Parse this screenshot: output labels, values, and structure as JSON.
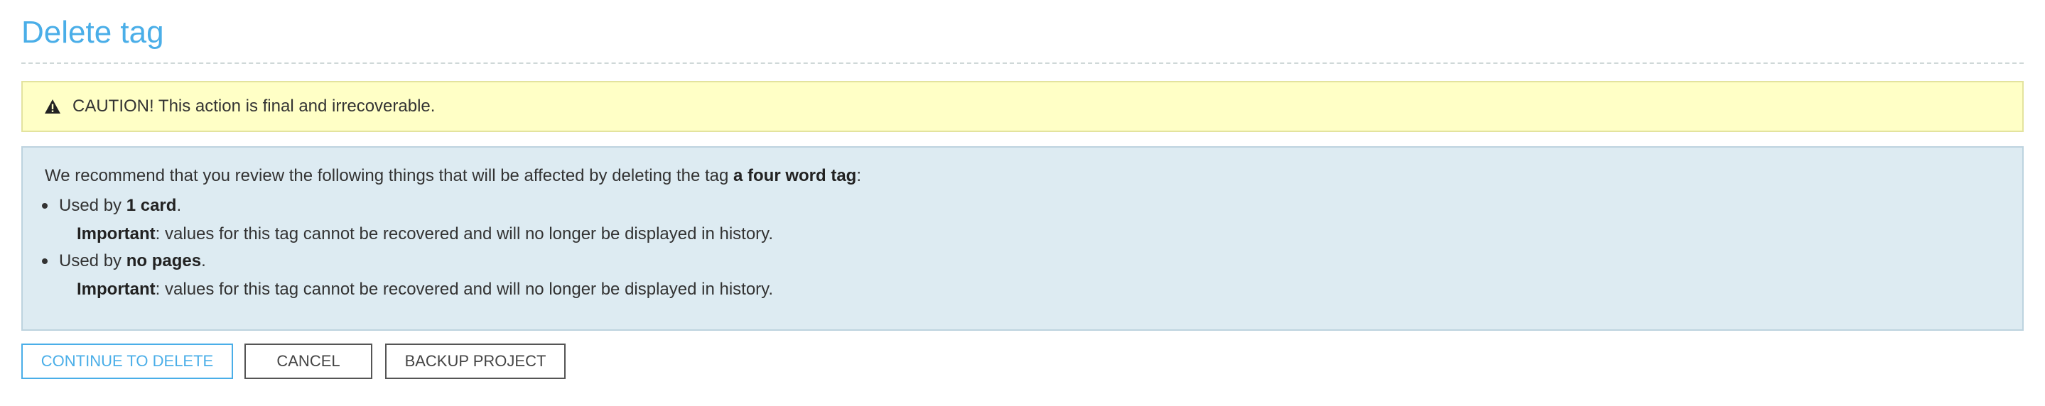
{
  "page": {
    "title": "Delete tag"
  },
  "caution": {
    "icon": "warning-triangle-icon",
    "text": "CAUTION! This action is final and irrecoverable."
  },
  "info": {
    "intro_prefix": "We recommend that you review the following things that will be affected by deleting the tag ",
    "tag_name": "a four word tag",
    "intro_suffix": ":",
    "items": [
      {
        "prefix": "Used by ",
        "count": "1 card",
        "suffix": ".",
        "note_label": "Important",
        "note_text": ": values for this tag cannot be recovered and will no longer be displayed in history."
      },
      {
        "prefix": "Used by ",
        "count": "no pages",
        "suffix": ".",
        "note_label": "Important",
        "note_text": ": values for this tag cannot be recovered and will no longer be displayed in history."
      }
    ]
  },
  "actions": {
    "continue_label": "CONTINUE TO DELETE",
    "cancel_label": "CANCEL",
    "backup_label": "BACKUP PROJECT"
  },
  "colors": {
    "accent": "#4aaee8",
    "caution_bg": "#ffffc6",
    "info_bg": "#ddebf2"
  }
}
